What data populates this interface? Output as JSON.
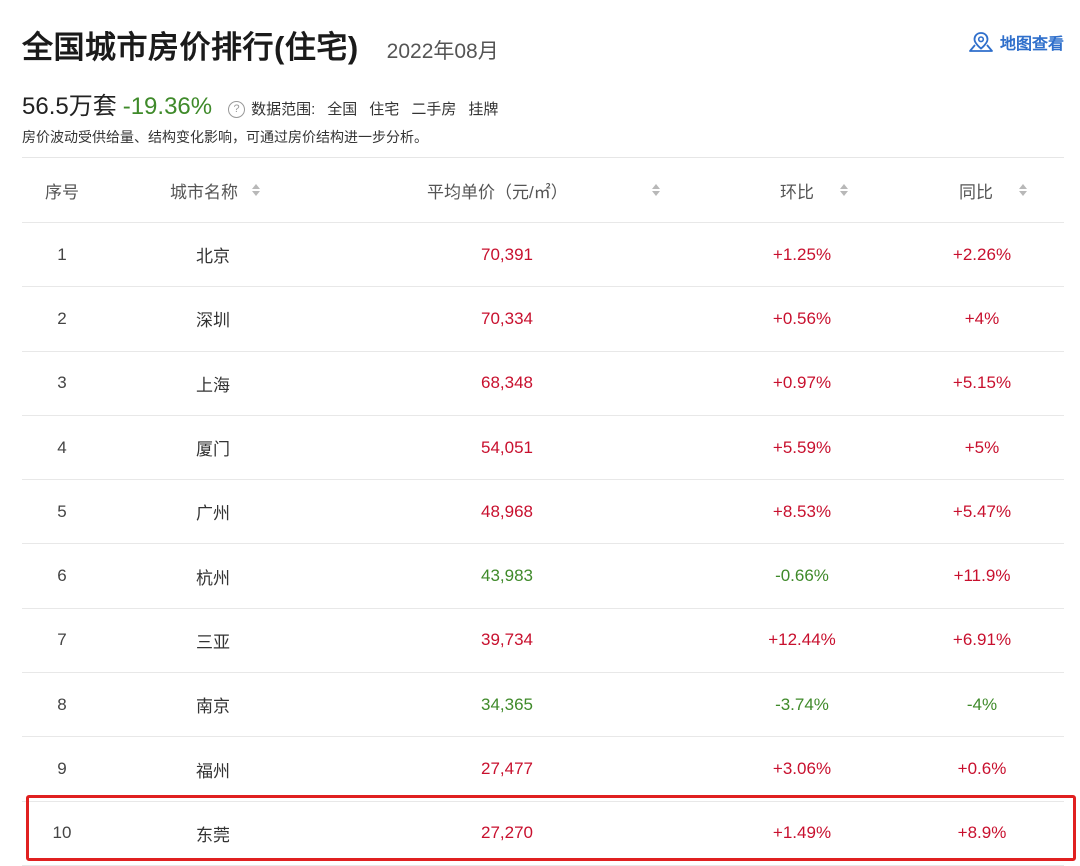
{
  "header": {
    "title": "全国城市房价排行(住宅)",
    "date": "2022年08月",
    "map_link": "地图查看",
    "map_icon": "map-pin-icon"
  },
  "summary": {
    "count": "56.5万套",
    "change": "-19.36%",
    "help_icon": "?",
    "range_label": "数据范围:",
    "range_items": [
      "全国",
      "住宅",
      "二手房",
      "挂牌"
    ],
    "note": "房价波动受供给量、结构变化影响，可通过房价结构进一步分析。"
  },
  "colors": {
    "up": "#c8102e",
    "down": "#3f8a2a",
    "link": "#2f6fcb",
    "highlight": "#e02020"
  },
  "table": {
    "headers": {
      "rank": "序号",
      "city": "城市名称",
      "price": "平均单价（元/㎡）",
      "mom": "环比",
      "yoy": "同比"
    },
    "rows": [
      {
        "rank": "1",
        "city": "北京",
        "price": "70,391",
        "mom": "+1.25%",
        "yoy": "+2.26%",
        "price_dir": "up",
        "mom_dir": "up",
        "yoy_dir": "up"
      },
      {
        "rank": "2",
        "city": "深圳",
        "price": "70,334",
        "mom": "+0.56%",
        "yoy": "+4%",
        "price_dir": "up",
        "mom_dir": "up",
        "yoy_dir": "up"
      },
      {
        "rank": "3",
        "city": "上海",
        "price": "68,348",
        "mom": "+0.97%",
        "yoy": "+5.15%",
        "price_dir": "up",
        "mom_dir": "up",
        "yoy_dir": "up"
      },
      {
        "rank": "4",
        "city": "厦门",
        "price": "54,051",
        "mom": "+5.59%",
        "yoy": "+5%",
        "price_dir": "up",
        "mom_dir": "up",
        "yoy_dir": "up"
      },
      {
        "rank": "5",
        "city": "广州",
        "price": "48,968",
        "mom": "+8.53%",
        "yoy": "+5.47%",
        "price_dir": "up",
        "mom_dir": "up",
        "yoy_dir": "up"
      },
      {
        "rank": "6",
        "city": "杭州",
        "price": "43,983",
        "mom": "-0.66%",
        "yoy": "+11.9%",
        "price_dir": "down",
        "mom_dir": "down",
        "yoy_dir": "up"
      },
      {
        "rank": "7",
        "city": "三亚",
        "price": "39,734",
        "mom": "+12.44%",
        "yoy": "+6.91%",
        "price_dir": "up",
        "mom_dir": "up",
        "yoy_dir": "up"
      },
      {
        "rank": "8",
        "city": "南京",
        "price": "34,365",
        "mom": "-3.74%",
        "yoy": "-4%",
        "price_dir": "down",
        "mom_dir": "down",
        "yoy_dir": "down"
      },
      {
        "rank": "9",
        "city": "福州",
        "price": "27,477",
        "mom": "+3.06%",
        "yoy": "+0.6%",
        "price_dir": "up",
        "mom_dir": "up",
        "yoy_dir": "up"
      },
      {
        "rank": "10",
        "city": "东莞",
        "price": "27,270",
        "mom": "+1.49%",
        "yoy": "+8.9%",
        "price_dir": "up",
        "mom_dir": "up",
        "yoy_dir": "up"
      }
    ]
  }
}
